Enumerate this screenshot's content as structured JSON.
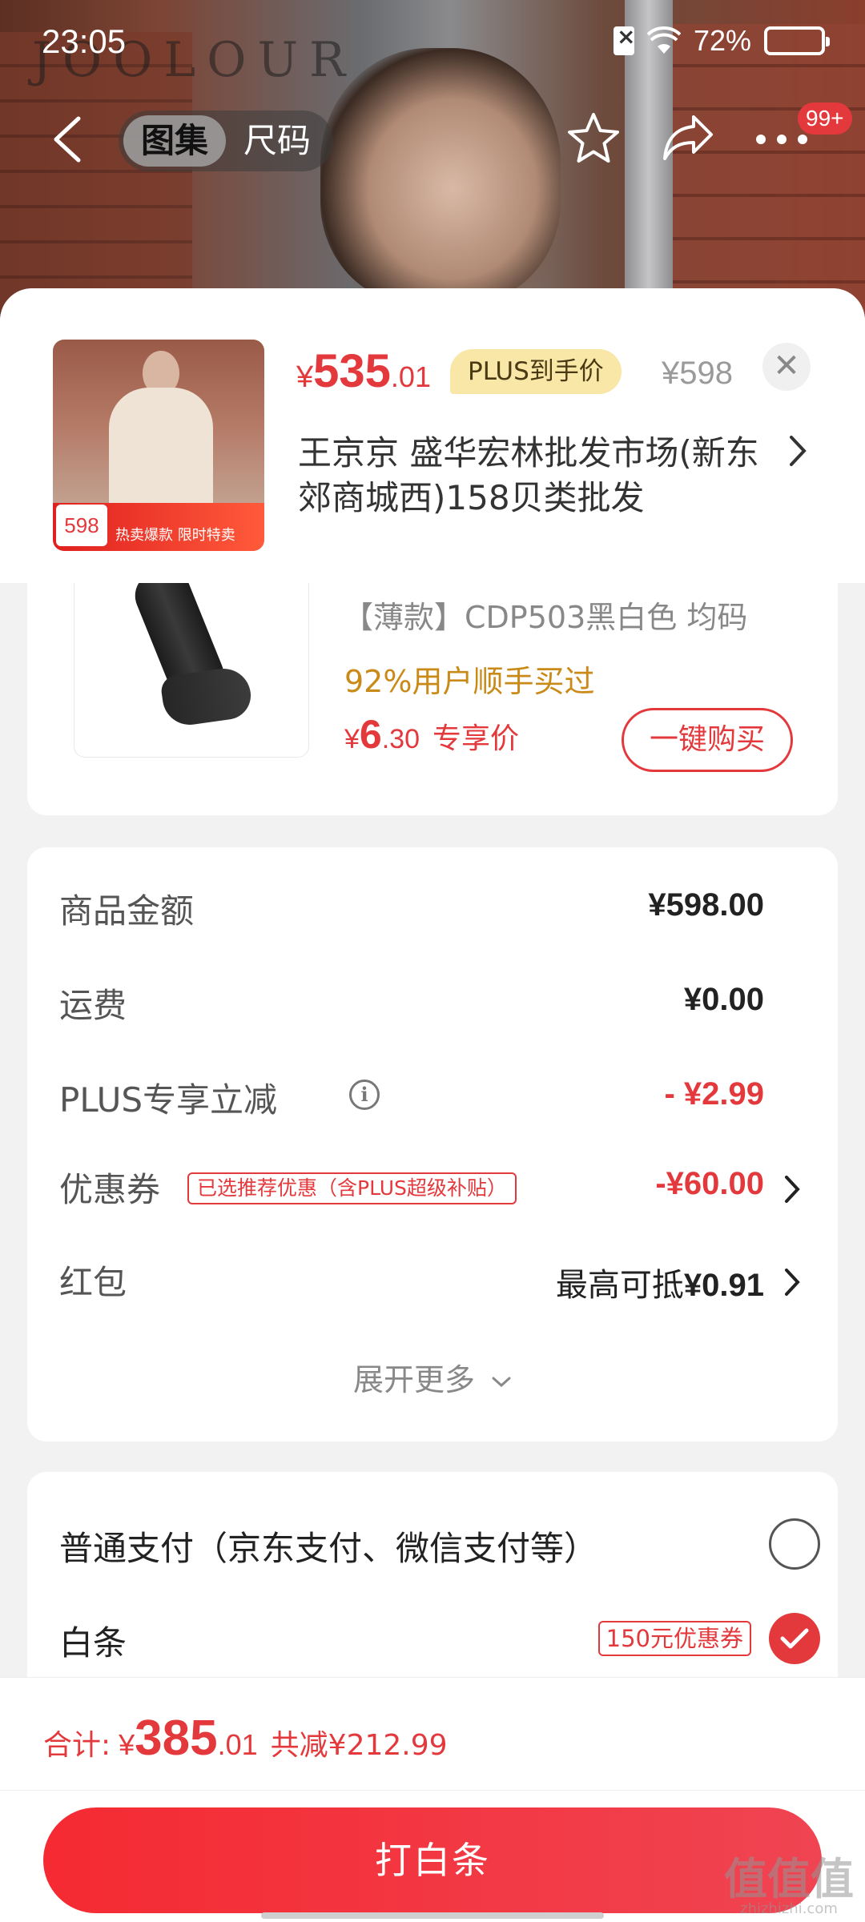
{
  "status_bar": {
    "time": "23:05",
    "battery_percent": "72%",
    "battery_level": 0.72,
    "icons": [
      "sim-off-icon",
      "wifi-icon",
      "battery-icon"
    ]
  },
  "top_nav": {
    "tabs": [
      {
        "label": "图集",
        "active": true
      },
      {
        "label": "尺码",
        "active": false
      }
    ],
    "badge": "99+",
    "icons": [
      "back-arrow-icon",
      "star-icon",
      "share-icon",
      "more-icon"
    ]
  },
  "product_header": {
    "currency": "¥",
    "price_int": "535",
    "price_dec": ".01",
    "plus_tag": "PLUS到手价",
    "original_price": "¥598",
    "shop_name": "王京京  盛华宏林批发市场(新东郊商城西)158贝类批发",
    "thumb_promo_price": "598",
    "thumb_promo_text": "热卖爆款 限时特卖"
  },
  "addon_product": {
    "sku": "【薄款】CDP503黑白色   均码",
    "bought_rate": "92%用户顺手买过",
    "currency": "¥",
    "price_int": "6",
    "price_dec": ".30",
    "price_label": "专享价",
    "buy_button": "一键购买"
  },
  "summary": {
    "rows": [
      {
        "label": "商品金额",
        "value": "¥598.00"
      },
      {
        "label": "运费",
        "value": "¥0.00"
      },
      {
        "label": "PLUS专享立减",
        "value": "- ¥2.99"
      },
      {
        "label": "优惠券",
        "tag": "已选推荐优惠（含PLUS超级补贴）",
        "value": "-¥60.00"
      },
      {
        "label": "红包",
        "value_prefix": "最高可抵",
        "value": "¥0.91"
      }
    ],
    "expand_more": "展开更多"
  },
  "payment": {
    "options": [
      {
        "label": "普通支付（京东支付、微信支付等）",
        "selected": false
      },
      {
        "label": "白条",
        "coupon": "150元优惠券",
        "selected": true
      }
    ]
  },
  "footer": {
    "total_label": "合计:",
    "currency": "¥",
    "total_int": "385",
    "total_dec": ".01",
    "saved": "共减¥212.99",
    "pay_button": "打白条"
  },
  "watermark": {
    "main": "值值值",
    "sub": "zhizhizhi.com"
  },
  "colors": {
    "accent_red": "#e4393c",
    "plus_gold": "#f8e7a6",
    "bought_orange": "#c98a18"
  }
}
